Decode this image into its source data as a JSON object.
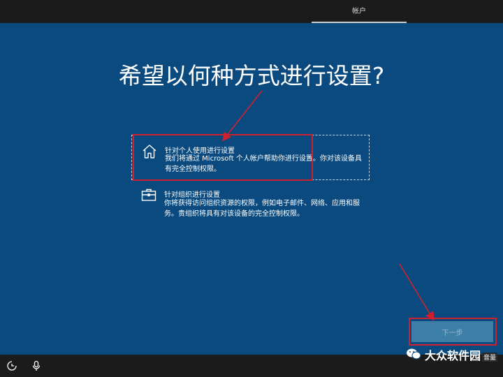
{
  "top_bar": {
    "tab_label": "帐户"
  },
  "heading": "希望以何种方式进行设置?",
  "options": [
    {
      "title": "针对个人使用进行设置",
      "description": "我们将通过 Microsoft 个人帐户帮助你进行设置。你对该设备具有完全控制权限。",
      "icon": "home-icon"
    },
    {
      "title": "针对组织进行设置",
      "description": "你将获得访问组织资源的权限，例如电子邮件、网络、应用和服务。贵组织将具有对该设备的完全控制权限。",
      "icon": "briefcase-icon"
    }
  ],
  "next_button": {
    "label": "下一步"
  },
  "watermark": {
    "text": "大众软件园",
    "corner_label": "音量"
  },
  "bottom_bar": {
    "icons": [
      "accessibility-icon",
      "microphone-icon"
    ]
  },
  "colors": {
    "background": "#0a4a7e",
    "bar": "#1b1b1b",
    "annotation": "#d0202e",
    "button": "#3e7fa8"
  }
}
